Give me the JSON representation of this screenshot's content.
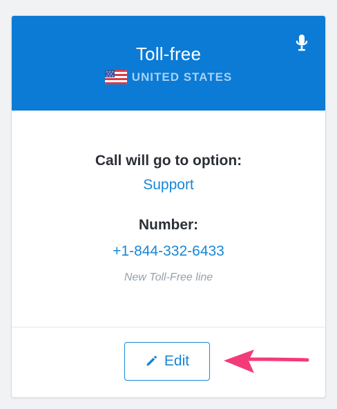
{
  "card": {
    "title": "Toll-free",
    "country": "UNITED STATES",
    "icons": {
      "flag": "us-flag-icon",
      "mic": "microphone-icon",
      "edit": "pencil-icon",
      "arrow": "arrow-annotation-icon"
    },
    "call_label": "Call will go to option:",
    "call_option": "Support",
    "number_label": "Number:",
    "number_value": "+1-844-332-6433",
    "number_note": "New Toll-Free line",
    "edit_label": "Edit"
  },
  "colors": {
    "header": "#0b7bd5",
    "link": "#1787d6",
    "annotation": "#f23b78"
  }
}
